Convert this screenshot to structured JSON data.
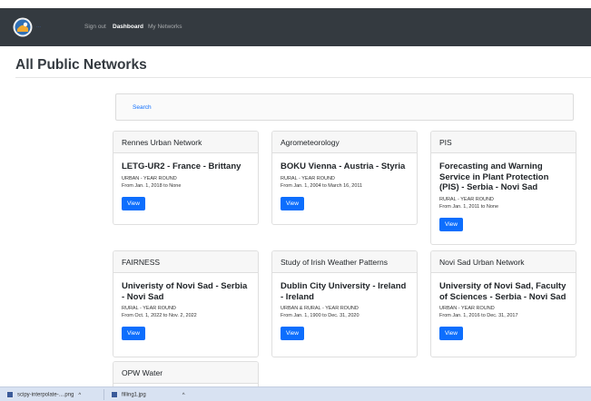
{
  "nav": {
    "logo_text": "...",
    "links": [
      {
        "label": "Sign out",
        "active": false
      },
      {
        "label": "Dashboard",
        "active": true
      },
      {
        "label": "My Networks",
        "active": false
      }
    ]
  },
  "page": {
    "title": "All Public Networks",
    "search_label": "Search"
  },
  "cards": [
    {
      "header": "Rennes Urban Network",
      "title": "LETG-UR2 - France - Brittany",
      "type": "URBAN - YEAR ROUND",
      "dates": "From Jan. 1, 2018 to None",
      "button": "View"
    },
    {
      "header": "Agrometeorology",
      "title": "BOKU Vienna - Austria - Styria",
      "type": "RURAL - YEAR ROUND",
      "dates": "From Jan. 1, 2004 to March 16, 2011",
      "button": "View"
    },
    {
      "header": "PIS",
      "title": "Forecasting and Warning Service in Plant Protection (PIS) - Serbia - Novi Sad",
      "type": "RURAL - YEAR ROUND",
      "dates": "From Jan. 1, 2011 to None",
      "button": "View"
    },
    {
      "header": "FAIRNESS",
      "title": "Univeristy of Novi Sad - Serbia - Novi Sad",
      "type": "RURAL - YEAR ROUND",
      "dates": "From Oct. 1, 2022 to Nov. 2, 2022",
      "button": "View"
    },
    {
      "header": "Study of Irish Weather Patterns",
      "title": "Dublin City University - Ireland - Ireland",
      "type": "URBAN & RURAL - YEAR ROUND",
      "dates": "From Jan. 1, 1900 to Dec. 31, 2020",
      "button": "View"
    },
    {
      "header": "Novi Sad Urban Network",
      "title": "University of Novi Sad, Faculty of Sciences - Serbia - Novi Sad",
      "type": "URBAN - YEAR ROUND",
      "dates": "From Jan. 1, 2016 to Dec. 31, 2017",
      "button": "View"
    },
    {
      "header": "OPW Water"
    }
  ],
  "downloads": [
    {
      "filename": "scipy-interpolate-....png"
    },
    {
      "filename": "filling1.jpg"
    }
  ],
  "colors": {
    "navbar": "#343a40",
    "primary": "#0d6efd",
    "taskbar": "#d8e2f2"
  }
}
